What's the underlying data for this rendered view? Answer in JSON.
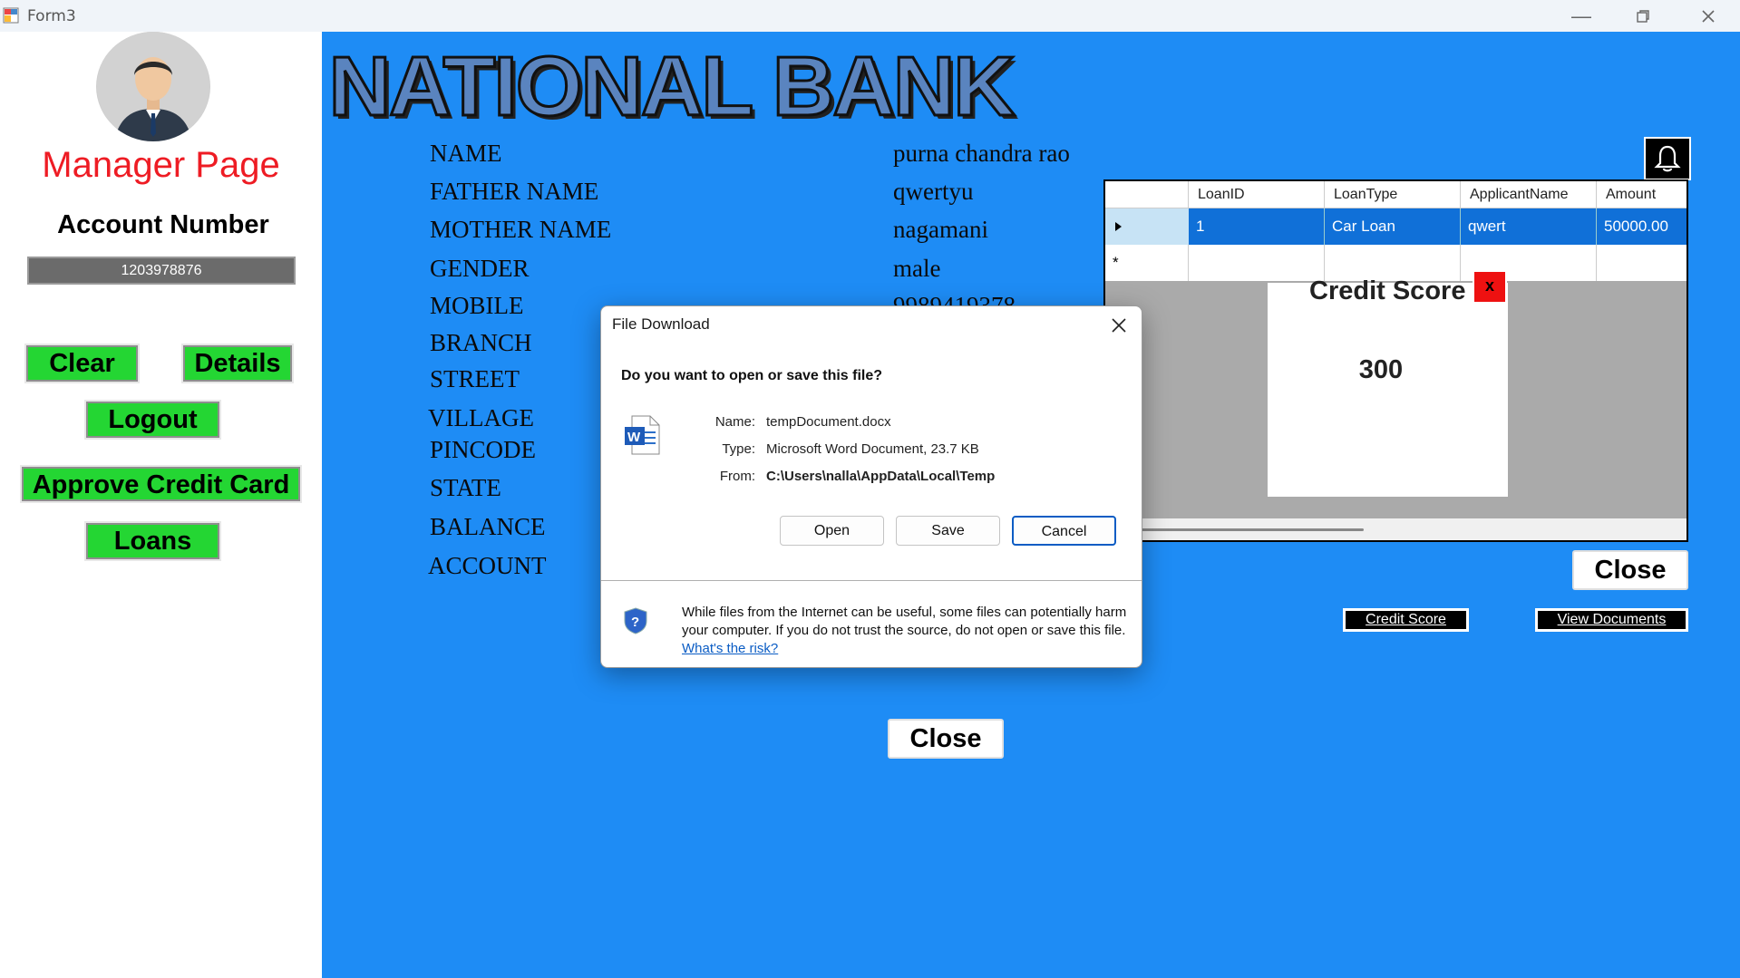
{
  "window": {
    "title": "Form3",
    "minimize_icon": "minimize-icon",
    "restore_icon": "restore-icon",
    "close_icon": "close-icon"
  },
  "sidebar": {
    "heading": "Manager Page",
    "account_label": "Account Number",
    "account_number": "1203978876",
    "buttons": {
      "clear": "Clear",
      "details": "Details",
      "logout": "Logout",
      "approve_credit_card": "Approve Credit Card",
      "loans": "Loans"
    },
    "button_color": "#24d633",
    "heading_color": "#ee1c24"
  },
  "main": {
    "bank_name": "NATIONAL BANK",
    "background_color": "#1e8cf5",
    "fields": [
      {
        "label": "NAME",
        "value": "purna chandra rao"
      },
      {
        "label": "FATHER NAME",
        "value": "qwertyu"
      },
      {
        "label": "MOTHER NAME",
        "value": "nagamani"
      },
      {
        "label": "GENDER",
        "value": "male"
      },
      {
        "label": "MOBILE",
        "value": "9989419378"
      },
      {
        "label": "BRANCH",
        "value": ""
      },
      {
        "label": "STREET",
        "value": ""
      },
      {
        "label": "VILLAGE",
        "value": ""
      },
      {
        "label": "PINCODE",
        "value": ""
      },
      {
        "label": "STATE",
        "value": ""
      },
      {
        "label": "BALANCE",
        "value": ""
      },
      {
        "label": "ACCOUNT",
        "value": ""
      }
    ],
    "close_label": "Close"
  },
  "loans": {
    "columns": [
      "LoanID",
      "LoanType",
      "ApplicantName",
      "Amount"
    ],
    "rows": [
      {
        "loan_id": "1",
        "loan_type": "Car Loan",
        "applicant": "qwert",
        "amount": "50000.00"
      }
    ],
    "new_row_marker": "*",
    "close_label": "Close",
    "credit_score_button": "Credit Score",
    "view_documents_button": "View Documents"
  },
  "credit_popup": {
    "title": "Credit Score",
    "close_glyph": "x",
    "score": "300"
  },
  "dialog": {
    "title": "File Download",
    "question": "Do you want to open or save this file?",
    "name_label": "Name:",
    "name_value": "tempDocument.docx",
    "type_label": "Type:",
    "type_value": "Microsoft Word Document, 23.7 KB",
    "from_label": "From:",
    "from_value": "C:\\Users\\nalla\\AppData\\Local\\Temp",
    "open": "Open",
    "save": "Save",
    "cancel": "Cancel",
    "warning": "While files from the Internet can be useful, some files can potentially harm your computer. If you do not trust the source, do not open or save this file.",
    "risk_link": "What's the risk?"
  }
}
